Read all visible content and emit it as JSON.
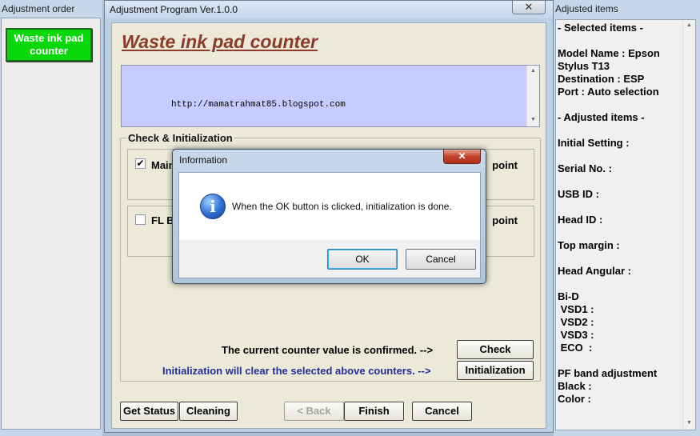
{
  "left_panel": {
    "title": "Adjustment order",
    "items": [
      {
        "label": "Waste ink pad counter",
        "color": "#0bd80b"
      }
    ]
  },
  "main_window": {
    "title": "Adjustment Program Ver.1.0.0",
    "close_glyph": "✕",
    "page_title": "Waste ink pad counter",
    "url_text": "http://mamatrahmat85.blogspot.com",
    "group_title": "Check & Initialization",
    "counters": [
      {
        "label_left": "Main",
        "label_right": "point",
        "checked": true
      },
      {
        "label_left": "FL B",
        "label_right": "point",
        "checked": false
      }
    ],
    "confirm_text": "The current counter value is confirmed. -->",
    "init_text": "Initialization will clear the selected above counters. -->",
    "check_button": "Check",
    "init_button": "Initialization",
    "bottom_buttons": {
      "get_status": "Get Status",
      "cleaning": "Cleaning",
      "back": "< Back",
      "finish": "Finish",
      "cancel": "Cancel"
    }
  },
  "right_panel": {
    "title": "Adjusted items",
    "lines": [
      "- Selected items -",
      "",
      "Model Name : Epson",
      "Stylus T13",
      "Destination : ESP",
      "Port : Auto selection",
      "",
      "- Adjusted items -",
      "",
      "Initial Setting :",
      "",
      "Serial No. :",
      "",
      "USB ID :",
      "",
      "Head ID :",
      "",
      "Top margin :",
      "",
      "Head Angular :",
      "",
      "Bi-D",
      " VSD1 :",
      " VSD2 :",
      " VSD3 :",
      " ECO  :",
      "",
      "PF band adjustment",
      "Black :",
      "Color :"
    ]
  },
  "dialog": {
    "title": "Information",
    "close_glyph": "✕",
    "icon": "info-icon",
    "message": "When the OK button is clicked, initialization is done.",
    "ok": "OK",
    "cancel": "Cancel"
  },
  "colors": {
    "accent_green": "#0bd80b",
    "page_title": "#8b3a2b",
    "init_text": "#1f2e9a",
    "url_box": "#c6ccff"
  }
}
